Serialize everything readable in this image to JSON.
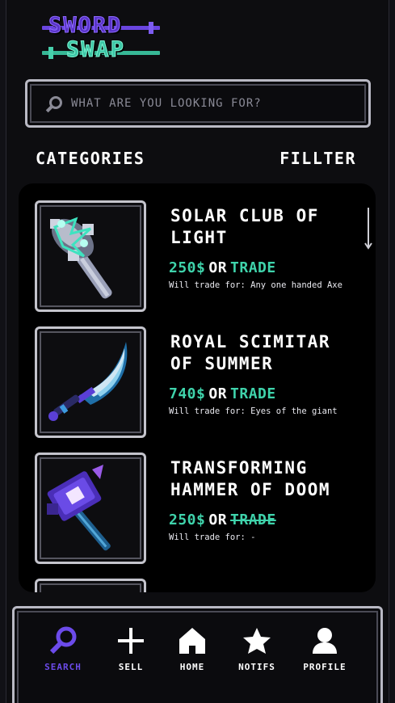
{
  "app": {
    "logo_line1": "SWORD",
    "logo_line2": "SWAP"
  },
  "search": {
    "placeholder": "WHAT ARE YOU LOOKING FOR?"
  },
  "toolbar": {
    "categories_label": "CATEGORIES",
    "filter_label": "FILLTER"
  },
  "listings": [
    {
      "title": "SOLAR CLUB OF LIGHT",
      "price": "250$",
      "or": "OR",
      "trade": "TRADE",
      "trade_available": true,
      "wants": "Will trade for: Any one handed Axe",
      "icon": "mace-icon"
    },
    {
      "title": "ROYAL SCIMITAR OF SUMMER",
      "price": "740$",
      "or": "OR",
      "trade": "TRADE",
      "trade_available": true,
      "wants": "Will trade for: Eyes of the giant",
      "icon": "scimitar-icon"
    },
    {
      "title": "TRANSFORMING HAMMER OF DOOM",
      "price": "250$",
      "or": "OR",
      "trade": "TRADE",
      "trade_available": false,
      "wants": "Will trade for: -",
      "icon": "hammer-icon"
    }
  ],
  "nav": {
    "search": "SEARCH",
    "sell": "SELL",
    "home": "HOME",
    "notifs": "NOTIFS",
    "profile": "PROFILE",
    "active": "search"
  },
  "colors": {
    "accent_purple": "#6c4bea",
    "accent_teal": "#3fd3ab",
    "background": "#0d0d10"
  }
}
